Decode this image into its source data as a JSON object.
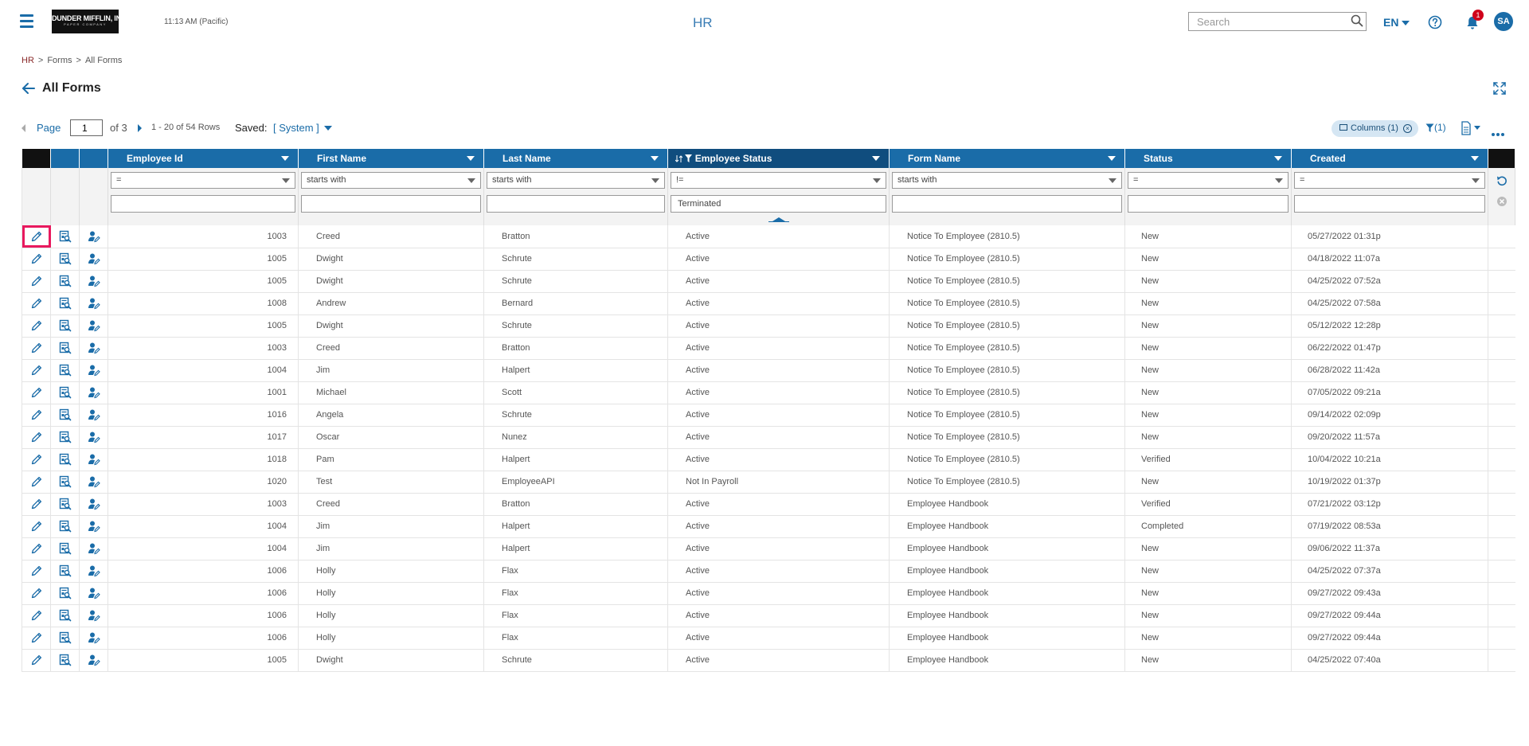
{
  "topbar": {
    "logo_line1": "DUNDER MIFFLIN, INC",
    "logo_line2": "PAPER COMPANY",
    "clock": "11:13 AM (Pacific)",
    "module_title": "HR",
    "search_placeholder": "Search",
    "language": "EN",
    "notification_count": "1",
    "avatar_initials": "SA"
  },
  "breadcrumb": [
    "HR",
    "Forms",
    "All Forms"
  ],
  "page": {
    "title": "All Forms"
  },
  "pager": {
    "page_label": "Page",
    "current_page": "1",
    "of_label": "of 3",
    "rows_label": "1 - 20 of 54 Rows",
    "saved_label": "Saved:",
    "saved_value": "[ System ]"
  },
  "toolbar": {
    "columns_label": "Columns (1)",
    "filter_count": "(1)"
  },
  "grid": {
    "columns": [
      {
        "label": "Employee Id",
        "operator": "=",
        "filter": ""
      },
      {
        "label": "First Name",
        "operator": "starts with",
        "filter": ""
      },
      {
        "label": "Last Name",
        "operator": "starts with",
        "filter": ""
      },
      {
        "label": "Employee Status",
        "operator": "!=",
        "filter": "Terminated"
      },
      {
        "label": "Form Name",
        "operator": "starts with",
        "filter": ""
      },
      {
        "label": "Status",
        "operator": "=",
        "filter": ""
      },
      {
        "label": "Created",
        "operator": "=",
        "filter": ""
      }
    ],
    "rows": [
      [
        "1003",
        "Creed",
        "Bratton",
        "Active",
        "Notice To Employee (2810.5)",
        "New",
        "05/27/2022 01:31p"
      ],
      [
        "1005",
        "Dwight",
        "Schrute",
        "Active",
        "Notice To Employee (2810.5)",
        "New",
        "04/18/2022 11:07a"
      ],
      [
        "1005",
        "Dwight",
        "Schrute",
        "Active",
        "Notice To Employee (2810.5)",
        "New",
        "04/25/2022 07:52a"
      ],
      [
        "1008",
        "Andrew",
        "Bernard",
        "Active",
        "Notice To Employee (2810.5)",
        "New",
        "04/25/2022 07:58a"
      ],
      [
        "1005",
        "Dwight",
        "Schrute",
        "Active",
        "Notice To Employee (2810.5)",
        "New",
        "05/12/2022 12:28p"
      ],
      [
        "1003",
        "Creed",
        "Bratton",
        "Active",
        "Notice To Employee (2810.5)",
        "New",
        "06/22/2022 01:47p"
      ],
      [
        "1004",
        "Jim",
        "Halpert",
        "Active",
        "Notice To Employee (2810.5)",
        "New",
        "06/28/2022 11:42a"
      ],
      [
        "1001",
        "Michael",
        "Scott",
        "Active",
        "Notice To Employee (2810.5)",
        "New",
        "07/05/2022 09:21a"
      ],
      [
        "1016",
        "Angela",
        "Schrute",
        "Active",
        "Notice To Employee (2810.5)",
        "New",
        "09/14/2022 02:09p"
      ],
      [
        "1017",
        "Oscar",
        "Nunez",
        "Active",
        "Notice To Employee (2810.5)",
        "New",
        "09/20/2022 11:57a"
      ],
      [
        "1018",
        "Pam",
        "Halpert",
        "Active",
        "Notice To Employee (2810.5)",
        "Verified",
        "10/04/2022 10:21a"
      ],
      [
        "1020",
        "Test",
        "EmployeeAPI",
        "Not In Payroll",
        "Notice To Employee (2810.5)",
        "New",
        "10/19/2022 01:37p"
      ],
      [
        "1003",
        "Creed",
        "Bratton",
        "Active",
        "Employee Handbook",
        "Verified",
        "07/21/2022 03:12p"
      ],
      [
        "1004",
        "Jim",
        "Halpert",
        "Active",
        "Employee Handbook",
        "Completed",
        "07/19/2022 08:53a"
      ],
      [
        "1004",
        "Jim",
        "Halpert",
        "Active",
        "Employee Handbook",
        "New",
        "09/06/2022 11:37a"
      ],
      [
        "1006",
        "Holly",
        "Flax",
        "Active",
        "Employee Handbook",
        "New",
        "04/25/2022 07:37a"
      ],
      [
        "1006",
        "Holly",
        "Flax",
        "Active",
        "Employee Handbook",
        "New",
        "09/27/2022 09:43a"
      ],
      [
        "1006",
        "Holly",
        "Flax",
        "Active",
        "Employee Handbook",
        "New",
        "09/27/2022 09:44a"
      ],
      [
        "1006",
        "Holly",
        "Flax",
        "Active",
        "Employee Handbook",
        "New",
        "09/27/2022 09:44a"
      ],
      [
        "1005",
        "Dwight",
        "Schrute",
        "Active",
        "Employee Handbook",
        "New",
        "04/25/2022 07:40a"
      ]
    ]
  },
  "icons": {
    "menu": "hamburger-icon",
    "search": "search-icon",
    "help": "help-icon",
    "notifications": "bell-icon",
    "back": "back-arrow-icon",
    "expand": "expand-icon",
    "row_edit": "pencil-icon",
    "row_view": "view-form-icon",
    "row_employee": "employee-edit-icon",
    "refresh": "refresh-icon",
    "clear": "clear-filter-icon"
  },
  "colors": {
    "primary": "#1a6ca8",
    "header_sorted": "#104d7e",
    "selection": "#e8195e",
    "badge": "#d0021b"
  }
}
